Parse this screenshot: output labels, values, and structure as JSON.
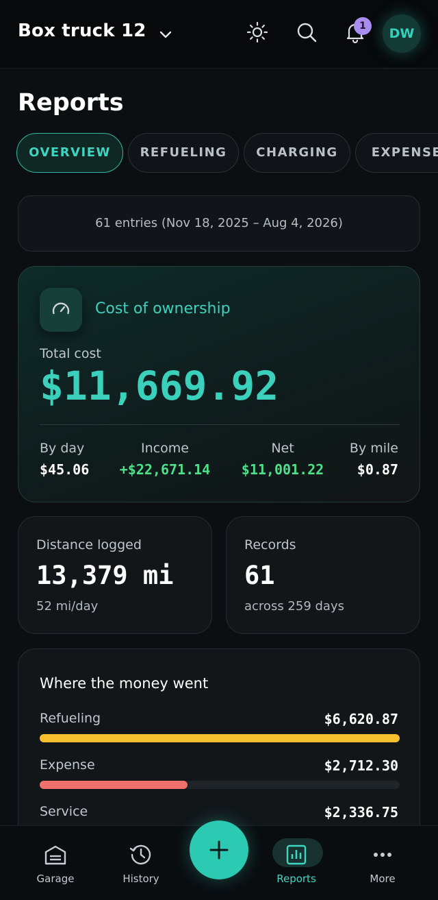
{
  "header": {
    "vehicle_name": "Box truck 12",
    "notification_count": "1",
    "avatar_initials": "DW",
    "icons": [
      "chevron-down-icon",
      "sun-icon",
      "search-icon",
      "bell-icon"
    ]
  },
  "page": {
    "title": "Reports"
  },
  "tabs": [
    {
      "label": "OVERVIEW",
      "active": true
    },
    {
      "label": "REFUELING",
      "active": false
    },
    {
      "label": "CHARGING",
      "active": false
    },
    {
      "label": "EXPENSE",
      "active": false
    }
  ],
  "summary": {
    "entries_text": "61 entries (Nov 18, 2025 – Aug 4, 2026)"
  },
  "cost": {
    "section_label": "Cost of ownership",
    "total_label": "Total cost",
    "total_value": "$11,669.92",
    "stats": [
      {
        "label": "By day",
        "value": "$45.06"
      },
      {
        "label": "Income",
        "value": "+$22,671.14"
      },
      {
        "label": "Net",
        "value": "$11,001.22"
      },
      {
        "label": "By mile",
        "value": "$0.87"
      }
    ]
  },
  "distance": {
    "label": "Distance logged",
    "value": "13,379 mi",
    "sub": "52 mi/day"
  },
  "records": {
    "label": "Records",
    "value": "61",
    "sub": "across 259 days"
  },
  "money": {
    "title": "Where the money went",
    "rows": [
      {
        "label": "Refueling",
        "value": "$6,620.87",
        "fraction": 1.0,
        "color": "#f5bf2e"
      },
      {
        "label": "Expense",
        "value": "$2,712.30",
        "fraction": 0.41,
        "color": "#f0706c"
      },
      {
        "label": "Service",
        "value": "$2,336.75",
        "fraction": 0.35,
        "color": "#1f9a86"
      }
    ]
  },
  "nav": {
    "items": [
      {
        "label": "Garage",
        "icon": "garage-icon"
      },
      {
        "label": "History",
        "icon": "history-icon"
      },
      {
        "label": "Reports",
        "icon": "reports-icon",
        "active": true
      },
      {
        "label": "More",
        "icon": "more-icon"
      }
    ],
    "fab_icon": "plus-icon"
  },
  "colors": {
    "accent": "#33d1bc",
    "positive": "#4ee08a",
    "background": "#0c0f12"
  }
}
